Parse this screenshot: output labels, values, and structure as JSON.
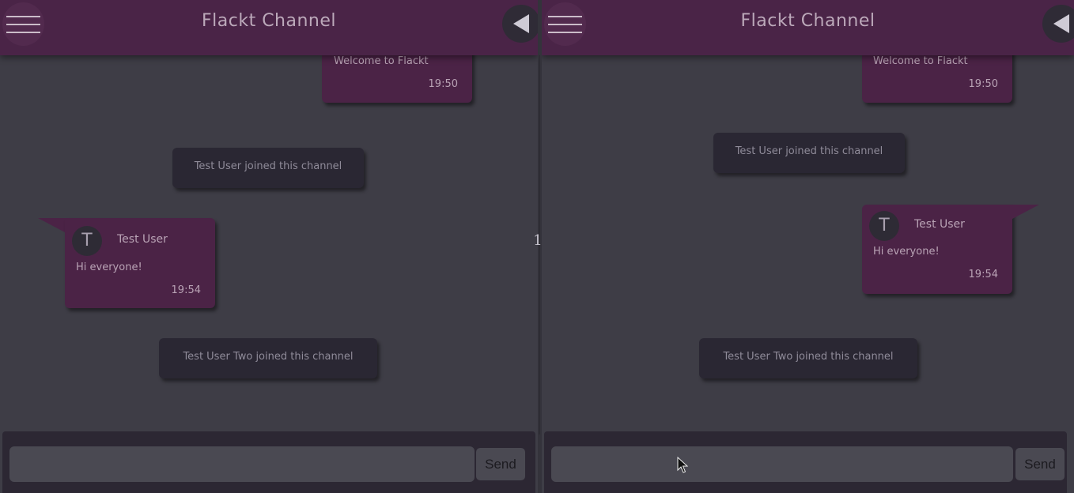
{
  "channel_title": "Flackt Channel",
  "messages": {
    "welcome": {
      "text": "Welcome to Flackt",
      "time": "19:50"
    },
    "join1": "Test User joined this channel",
    "user_msg": {
      "author": "Test User",
      "initial": "T",
      "text": "Hi everyone!",
      "time": "19:54"
    },
    "join2": "Test User Two joined this channel"
  },
  "divider_label": "1",
  "composer": {
    "placeholder": "",
    "value": "",
    "send_label": "Send"
  },
  "colors": {
    "topbar": "#4a2447",
    "background": "#3e3d46",
    "bubble": "#4b2346",
    "system_bubble": "#2a2733"
  }
}
